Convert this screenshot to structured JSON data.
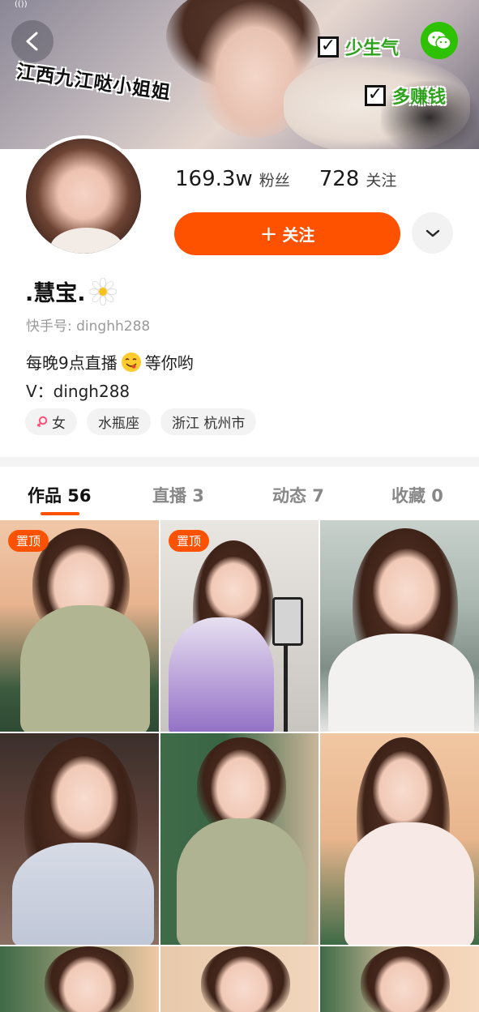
{
  "banner": {
    "left_text": "江西九江哒小姐姐",
    "checks": [
      "少生气",
      "多赚钱"
    ],
    "status_mini": "(())"
  },
  "profile": {
    "followers_value": "169.3w",
    "followers_label": "粉丝",
    "following_value": "728",
    "following_label": "关注",
    "follow_button": "关注",
    "follow_plus": "+",
    "name": ".慧宝.",
    "kuaishou_id": "快手号: dinghh288",
    "bio_line1_a": "每晚9点直播",
    "bio_line1_b": "等你哟",
    "bio_line2": "V：dingh288",
    "tags": [
      {
        "label": "女",
        "icon": "female-icon"
      },
      {
        "label": "水瓶座"
      },
      {
        "label": "浙江 杭州市"
      }
    ]
  },
  "tabs": [
    {
      "label": "作品 56",
      "active": true
    },
    {
      "label": "直播 3",
      "active": false
    },
    {
      "label": "动态 7",
      "active": false
    },
    {
      "label": "收藏 0",
      "active": false
    }
  ],
  "grid": {
    "pinned_label": "置顶"
  },
  "colors": {
    "accent": "#fe5200",
    "wechat": "#2dc100",
    "check_text": "#2ea21d"
  }
}
